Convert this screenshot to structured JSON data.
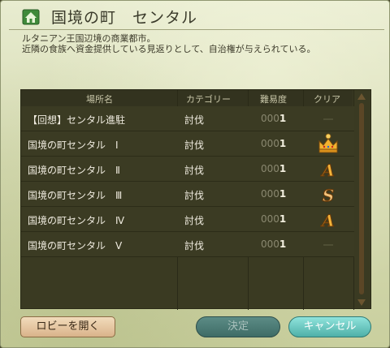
{
  "header": {
    "title": "国境の町　センタル",
    "home_icon": "home-icon"
  },
  "description": {
    "line1": "ルタニアン王国辺境の商業都市。",
    "line2": "近隣の食族へ資金提供している見返りとして、自治権が与えられている。"
  },
  "table": {
    "columns": {
      "name": "場所名",
      "category": "カテゴリー",
      "difficulty": "難易度",
      "clear": "クリア"
    },
    "rows": [
      {
        "name": "【回想】センタル進駐",
        "category": "討伐",
        "diff_lead": "000",
        "diff_num": "1",
        "clear": "none"
      },
      {
        "name": "国境の町センタル　Ⅰ",
        "category": "討伐",
        "diff_lead": "000",
        "diff_num": "1",
        "clear": "crown"
      },
      {
        "name": "国境の町センタル　Ⅱ",
        "category": "討伐",
        "diff_lead": "000",
        "diff_num": "1",
        "clear": "A"
      },
      {
        "name": "国境の町センタル　Ⅲ",
        "category": "討伐",
        "diff_lead": "000",
        "diff_num": "1",
        "clear": "S"
      },
      {
        "name": "国境の町センタル　Ⅳ",
        "category": "討伐",
        "diff_lead": "000",
        "diff_num": "1",
        "clear": "A"
      },
      {
        "name": "国境の町センタル　Ⅴ",
        "category": "討伐",
        "diff_lead": "000",
        "diff_num": "1",
        "clear": "none"
      }
    ]
  },
  "buttons": {
    "lobby": "ロビーを開く",
    "ok": "決定",
    "cancel": "キャンセル"
  },
  "colors": {
    "panel_bg": "#3a3a22",
    "rank_gold": "#f2b230",
    "cancel_accent": "#6fd0c8"
  }
}
